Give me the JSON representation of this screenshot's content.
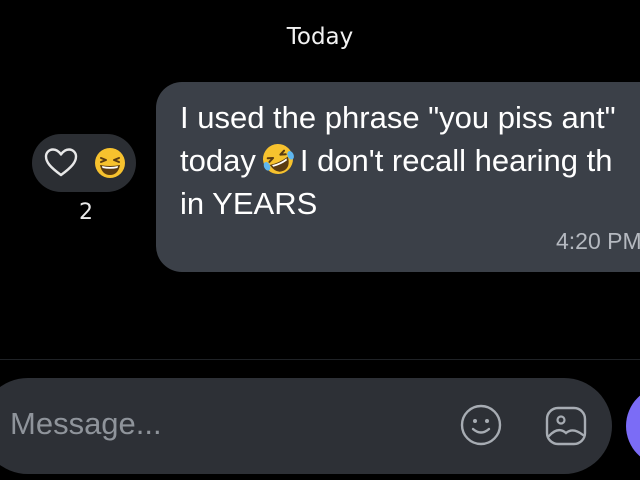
{
  "conversation": {
    "date_divider": "Today",
    "message": {
      "line1": "I used the phrase \"you piss ant\"",
      "line2_before": "today",
      "line2_after": "I don't recall hearing th",
      "line3": "in YEARS",
      "inline_emoji": "rolling-on-floor-laughing-emoji",
      "time": "4:20 PM"
    },
    "reactions": {
      "heart_icon": "heart-outline-icon",
      "emoji": "grinning-squinting-face-emoji",
      "count": "2"
    }
  },
  "composer": {
    "placeholder": "Message...",
    "emoji_icon": "smiley-face-icon",
    "attach_icon": "image-icon"
  },
  "colors": {
    "background": "#000000",
    "bubble": "#3b4048",
    "composer": "#2d3036",
    "send_button": "#7b6cf6",
    "emoji_yellow": "#f7c22e"
  }
}
